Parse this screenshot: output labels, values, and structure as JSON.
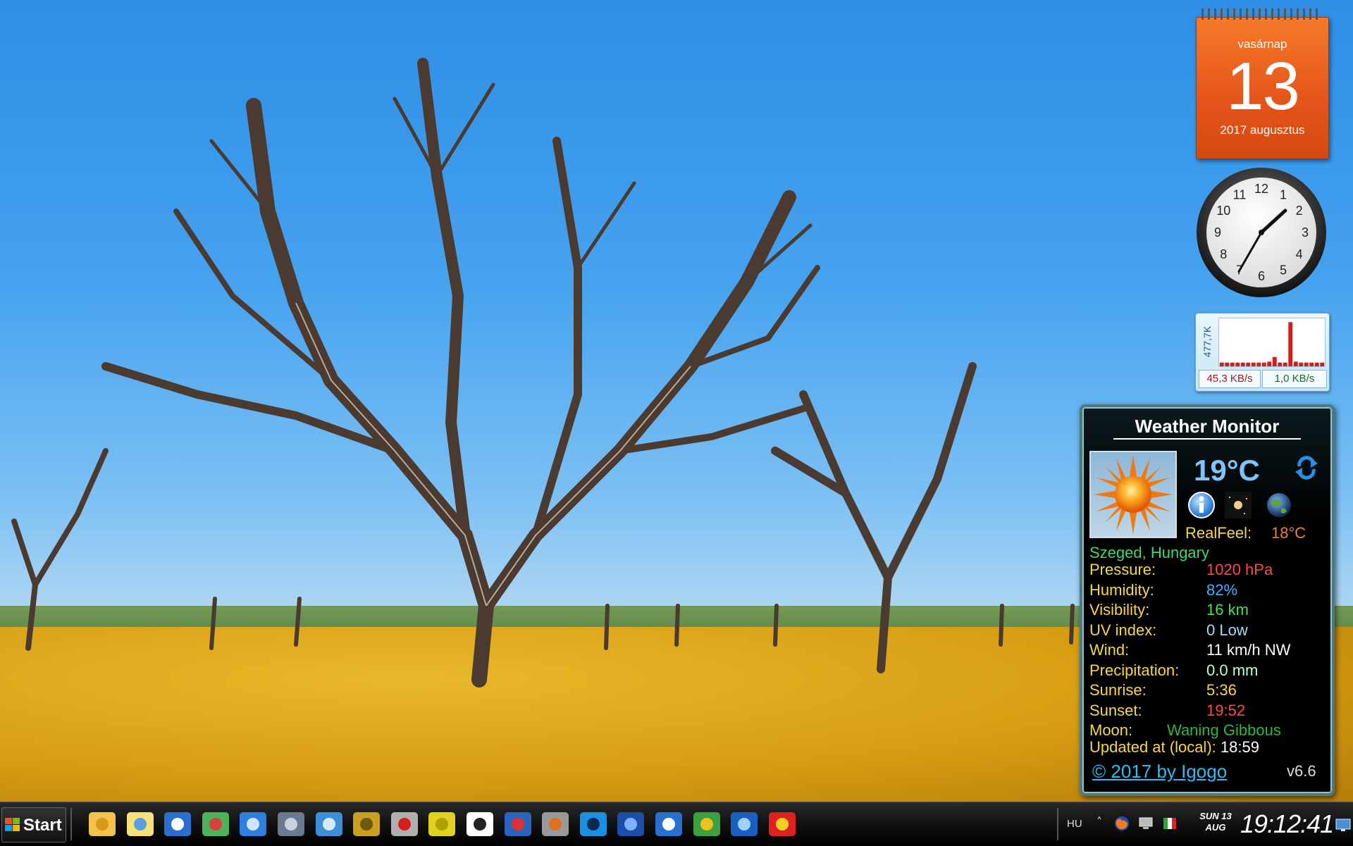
{
  "calendar": {
    "weekday": "vasárnap",
    "day": "13",
    "month_year": "2017 augusztus"
  },
  "clock": {
    "numerals": [
      "12",
      "1",
      "2",
      "3",
      "4",
      "5",
      "6",
      "7",
      "8",
      "9",
      "10",
      "11"
    ],
    "hour": 1,
    "minute": 35
  },
  "netmeter": {
    "scale_label": "477,7K",
    "download": "45,3 KB/s",
    "upload": "1,0 KB/s",
    "bars": [
      0.08,
      0.08,
      0.08,
      0.08,
      0.08,
      0.08,
      0.08,
      0.08,
      0.08,
      0.1,
      0.2,
      0.08,
      0.08,
      0.95,
      0.1,
      0.08,
      0.08,
      0.08,
      0.08,
      0.08
    ],
    "bar_color": "#d61a1a"
  },
  "weather": {
    "title": "Weather Monitor",
    "temp": "19°C",
    "realfeel_label": "RealFeel:",
    "realfeel_value": "18°C",
    "location": "Szeged, Hungary",
    "rows": [
      {
        "label": "Pressure:",
        "value": "1020 hPa",
        "color": "#ff4a4a"
      },
      {
        "label": "Humidity:",
        "value": "82%",
        "color": "#3fb4ff"
      },
      {
        "label": "Visibility:",
        "value": "16 km",
        "color": "#49e34d"
      },
      {
        "label": "UV index:",
        "value": "0 Low",
        "color": "#9fdcff"
      },
      {
        "label": "Wind:",
        "value": "11 km/h NW",
        "color": "#ffffff"
      },
      {
        "label": "Precipitation:",
        "value": "0.0 mm",
        "color": "#b8ffda"
      },
      {
        "label": "Sunrise:",
        "value": "5:36",
        "color": "#f7d64a"
      },
      {
        "label": "Sunset:",
        "value": "19:52",
        "color": "#ff4a4a"
      },
      {
        "label": "Moon:",
        "value": "Waning Gibbous",
        "color": "#2fb93a"
      }
    ],
    "updated_label": "Updated at (local):",
    "updated_value": "18:59",
    "copyright": "© 2017 by Igogo",
    "version": "v6.6"
  },
  "taskbar": {
    "start_label": "Start",
    "pinned": [
      {
        "name": "file-explorer-icon"
      },
      {
        "name": "sticky-notes-icon"
      },
      {
        "name": "heart-app-icon"
      },
      {
        "name": "water-temperature-app-icon"
      },
      {
        "name": "display-settings-icon"
      },
      {
        "name": "computer-toolbox-icon"
      },
      {
        "name": "monitor-app-icon"
      },
      {
        "name": "yellow-disc-helper-icon"
      },
      {
        "name": "help-rabbit-icon"
      },
      {
        "name": "yellow-cd-icon"
      },
      {
        "name": "cat-mask-icon"
      },
      {
        "name": "floppy-64-icon"
      },
      {
        "name": "mp3-film-icon"
      },
      {
        "name": "play-arrow-icon"
      },
      {
        "name": "blue-books-icon"
      },
      {
        "name": "sync-circle-icon"
      },
      {
        "name": "globe-download-icon"
      },
      {
        "name": "thunderbird-icon"
      },
      {
        "name": "red-diamond-app-icon"
      }
    ],
    "tray": {
      "language": "HU",
      "day_line1": "SUN 13",
      "day_line2": "AUG",
      "time": "19:12:41"
    }
  }
}
